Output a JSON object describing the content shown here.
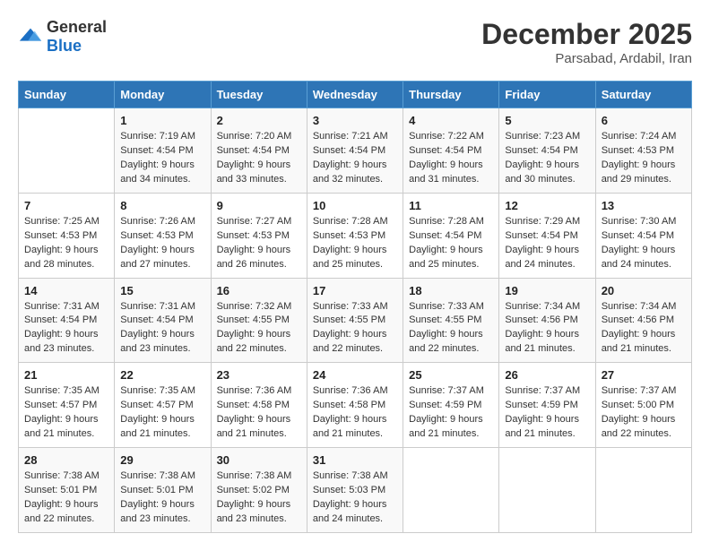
{
  "logo": {
    "general": "General",
    "blue": "Blue"
  },
  "title": "December 2025",
  "location": "Parsabad, Ardabil, Iran",
  "days_header": [
    "Sunday",
    "Monday",
    "Tuesday",
    "Wednesday",
    "Thursday",
    "Friday",
    "Saturday"
  ],
  "weeks": [
    [
      {
        "day": "",
        "sunrise": "",
        "sunset": "",
        "daylight": ""
      },
      {
        "day": "1",
        "sunrise": "Sunrise: 7:19 AM",
        "sunset": "Sunset: 4:54 PM",
        "daylight": "Daylight: 9 hours and 34 minutes."
      },
      {
        "day": "2",
        "sunrise": "Sunrise: 7:20 AM",
        "sunset": "Sunset: 4:54 PM",
        "daylight": "Daylight: 9 hours and 33 minutes."
      },
      {
        "day": "3",
        "sunrise": "Sunrise: 7:21 AM",
        "sunset": "Sunset: 4:54 PM",
        "daylight": "Daylight: 9 hours and 32 minutes."
      },
      {
        "day": "4",
        "sunrise": "Sunrise: 7:22 AM",
        "sunset": "Sunset: 4:54 PM",
        "daylight": "Daylight: 9 hours and 31 minutes."
      },
      {
        "day": "5",
        "sunrise": "Sunrise: 7:23 AM",
        "sunset": "Sunset: 4:54 PM",
        "daylight": "Daylight: 9 hours and 30 minutes."
      },
      {
        "day": "6",
        "sunrise": "Sunrise: 7:24 AM",
        "sunset": "Sunset: 4:53 PM",
        "daylight": "Daylight: 9 hours and 29 minutes."
      }
    ],
    [
      {
        "day": "7",
        "sunrise": "Sunrise: 7:25 AM",
        "sunset": "Sunset: 4:53 PM",
        "daylight": "Daylight: 9 hours and 28 minutes."
      },
      {
        "day": "8",
        "sunrise": "Sunrise: 7:26 AM",
        "sunset": "Sunset: 4:53 PM",
        "daylight": "Daylight: 9 hours and 27 minutes."
      },
      {
        "day": "9",
        "sunrise": "Sunrise: 7:27 AM",
        "sunset": "Sunset: 4:53 PM",
        "daylight": "Daylight: 9 hours and 26 minutes."
      },
      {
        "day": "10",
        "sunrise": "Sunrise: 7:28 AM",
        "sunset": "Sunset: 4:53 PM",
        "daylight": "Daylight: 9 hours and 25 minutes."
      },
      {
        "day": "11",
        "sunrise": "Sunrise: 7:28 AM",
        "sunset": "Sunset: 4:54 PM",
        "daylight": "Daylight: 9 hours and 25 minutes."
      },
      {
        "day": "12",
        "sunrise": "Sunrise: 7:29 AM",
        "sunset": "Sunset: 4:54 PM",
        "daylight": "Daylight: 9 hours and 24 minutes."
      },
      {
        "day": "13",
        "sunrise": "Sunrise: 7:30 AM",
        "sunset": "Sunset: 4:54 PM",
        "daylight": "Daylight: 9 hours and 24 minutes."
      }
    ],
    [
      {
        "day": "14",
        "sunrise": "Sunrise: 7:31 AM",
        "sunset": "Sunset: 4:54 PM",
        "daylight": "Daylight: 9 hours and 23 minutes."
      },
      {
        "day": "15",
        "sunrise": "Sunrise: 7:31 AM",
        "sunset": "Sunset: 4:54 PM",
        "daylight": "Daylight: 9 hours and 23 minutes."
      },
      {
        "day": "16",
        "sunrise": "Sunrise: 7:32 AM",
        "sunset": "Sunset: 4:55 PM",
        "daylight": "Daylight: 9 hours and 22 minutes."
      },
      {
        "day": "17",
        "sunrise": "Sunrise: 7:33 AM",
        "sunset": "Sunset: 4:55 PM",
        "daylight": "Daylight: 9 hours and 22 minutes."
      },
      {
        "day": "18",
        "sunrise": "Sunrise: 7:33 AM",
        "sunset": "Sunset: 4:55 PM",
        "daylight": "Daylight: 9 hours and 22 minutes."
      },
      {
        "day": "19",
        "sunrise": "Sunrise: 7:34 AM",
        "sunset": "Sunset: 4:56 PM",
        "daylight": "Daylight: 9 hours and 21 minutes."
      },
      {
        "day": "20",
        "sunrise": "Sunrise: 7:34 AM",
        "sunset": "Sunset: 4:56 PM",
        "daylight": "Daylight: 9 hours and 21 minutes."
      }
    ],
    [
      {
        "day": "21",
        "sunrise": "Sunrise: 7:35 AM",
        "sunset": "Sunset: 4:57 PM",
        "daylight": "Daylight: 9 hours and 21 minutes."
      },
      {
        "day": "22",
        "sunrise": "Sunrise: 7:35 AM",
        "sunset": "Sunset: 4:57 PM",
        "daylight": "Daylight: 9 hours and 21 minutes."
      },
      {
        "day": "23",
        "sunrise": "Sunrise: 7:36 AM",
        "sunset": "Sunset: 4:58 PM",
        "daylight": "Daylight: 9 hours and 21 minutes."
      },
      {
        "day": "24",
        "sunrise": "Sunrise: 7:36 AM",
        "sunset": "Sunset: 4:58 PM",
        "daylight": "Daylight: 9 hours and 21 minutes."
      },
      {
        "day": "25",
        "sunrise": "Sunrise: 7:37 AM",
        "sunset": "Sunset: 4:59 PM",
        "daylight": "Daylight: 9 hours and 21 minutes."
      },
      {
        "day": "26",
        "sunrise": "Sunrise: 7:37 AM",
        "sunset": "Sunset: 4:59 PM",
        "daylight": "Daylight: 9 hours and 21 minutes."
      },
      {
        "day": "27",
        "sunrise": "Sunrise: 7:37 AM",
        "sunset": "Sunset: 5:00 PM",
        "daylight": "Daylight: 9 hours and 22 minutes."
      }
    ],
    [
      {
        "day": "28",
        "sunrise": "Sunrise: 7:38 AM",
        "sunset": "Sunset: 5:01 PM",
        "daylight": "Daylight: 9 hours and 22 minutes."
      },
      {
        "day": "29",
        "sunrise": "Sunrise: 7:38 AM",
        "sunset": "Sunset: 5:01 PM",
        "daylight": "Daylight: 9 hours and 23 minutes."
      },
      {
        "day": "30",
        "sunrise": "Sunrise: 7:38 AM",
        "sunset": "Sunset: 5:02 PM",
        "daylight": "Daylight: 9 hours and 23 minutes."
      },
      {
        "day": "31",
        "sunrise": "Sunrise: 7:38 AM",
        "sunset": "Sunset: 5:03 PM",
        "daylight": "Daylight: 9 hours and 24 minutes."
      },
      {
        "day": "",
        "sunrise": "",
        "sunset": "",
        "daylight": ""
      },
      {
        "day": "",
        "sunrise": "",
        "sunset": "",
        "daylight": ""
      },
      {
        "day": "",
        "sunrise": "",
        "sunset": "",
        "daylight": ""
      }
    ]
  ]
}
